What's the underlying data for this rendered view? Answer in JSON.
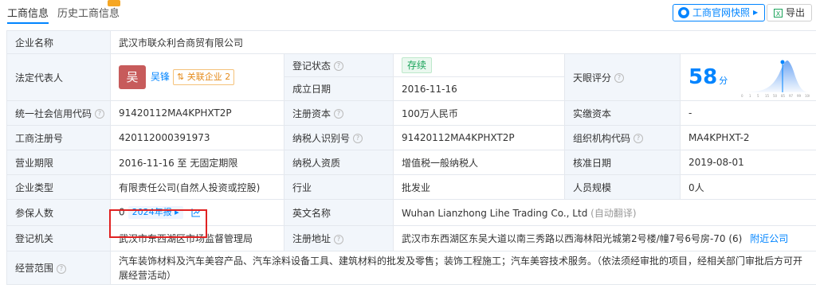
{
  "tabs": {
    "active": "工商信息",
    "history": "历史工商信息"
  },
  "actions": {
    "snapshot_label": "工商官网快照",
    "export_label": "导出"
  },
  "rows": {
    "company_name": {
      "label": "企业名称",
      "value": "武汉市联众利合商贸有限公司"
    },
    "legal_rep": {
      "label": "法定代表人",
      "avatar_char": "吴",
      "name": "吴锋",
      "related_label": "关联企业",
      "related_count": "2"
    },
    "reg_status": {
      "label": "登记状态",
      "value": "存续"
    },
    "founded": {
      "label": "成立日期",
      "value": "2016-11-16"
    },
    "score": {
      "label": "天眼评分",
      "value": "58",
      "unit": "分",
      "ticks": [
        "0",
        "1",
        "5",
        "15",
        "50",
        "85",
        "97",
        "99",
        "100"
      ]
    },
    "credit_code": {
      "label": "统一社会信用代码",
      "value": "91420112MA4KPHXT2P"
    },
    "reg_capital": {
      "label": "注册资本",
      "value": "100万人民币"
    },
    "paid_capital": {
      "label": "实缴资本",
      "value": "-"
    },
    "reg_number": {
      "label": "工商注册号",
      "value": "420112000391973"
    },
    "taxpayer_id": {
      "label": "纳税人识别号",
      "value": "91420112MA4KPHXT2P"
    },
    "org_code": {
      "label": "组织机构代码",
      "value": "MA4KPHXT-2"
    },
    "term": {
      "label": "营业期限",
      "value": "2016-11-16 至 无固定期限"
    },
    "taxpayer_qual": {
      "label": "纳税人资质",
      "value": "增值税一般纳税人"
    },
    "approval_date": {
      "label": "核准日期",
      "value": "2019-08-01"
    },
    "company_type": {
      "label": "企业类型",
      "value": "有限责任公司(自然人投资或控股)"
    },
    "industry": {
      "label": "行业",
      "value": "批发业"
    },
    "staff_size": {
      "label": "人员规模",
      "value": "0人"
    },
    "insured": {
      "label": "参保人数",
      "value": "0",
      "report": "2024年报"
    },
    "english_name": {
      "label": "英文名称",
      "value": "Wuhan Lianzhong Lihe Trading Co., Ltd",
      "note": "(自动翻译)"
    },
    "authority": {
      "label": "登记机关",
      "value": "武汉市东西湖区市场监督管理局"
    },
    "address": {
      "label": "注册地址",
      "value": "武汉市东西湖区东吴大道以南三秀路以西海林阳光城第2号楼/幢7号6号房-70 (6)",
      "nearby": "附近公司"
    },
    "scope": {
      "label": "经营范围",
      "value": "汽车装饰材料及汽车美容产品、汽车涂料设备工具、建筑材料的批发及零售；装饰工程施工；汽车美容技术服务。（依法须经审批的项目，经相关部门审批后方可开展经营活动）"
    }
  }
}
